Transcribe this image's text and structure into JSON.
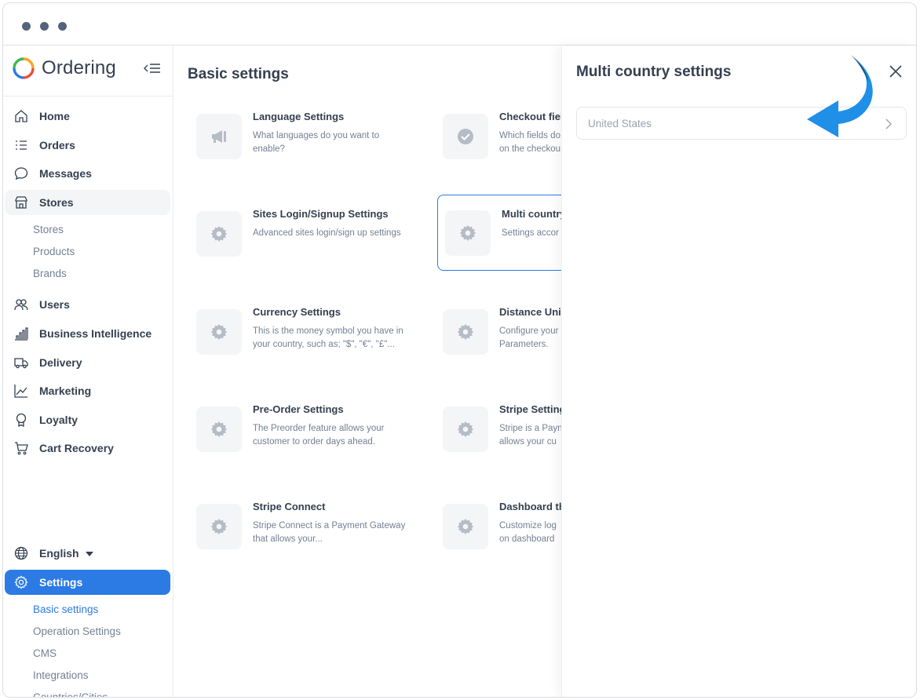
{
  "app": {
    "brand": "Ordering"
  },
  "sidebar": {
    "nav": [
      {
        "label": "Home",
        "icon": "home-icon"
      },
      {
        "label": "Orders",
        "icon": "list-icon"
      },
      {
        "label": "Messages",
        "icon": "chat-icon"
      },
      {
        "label": "Stores",
        "icon": "shop-icon"
      },
      {
        "label": "Users",
        "icon": "users-icon"
      },
      {
        "label": "Business Intelligence",
        "icon": "bar-chart-icon"
      },
      {
        "label": "Delivery",
        "icon": "truck-icon"
      },
      {
        "label": "Marketing",
        "icon": "graph-icon"
      },
      {
        "label": "Loyalty",
        "icon": "award-icon"
      },
      {
        "label": "Cart Recovery",
        "icon": "cart-icon"
      }
    ],
    "stores_sub": [
      "Stores",
      "Products",
      "Brands"
    ],
    "language": "English",
    "settings_label": "Settings",
    "settings_sub": [
      "Basic settings",
      "Operation Settings",
      "CMS",
      "Integrations",
      "Countries/Cities"
    ]
  },
  "main": {
    "title": "Basic settings",
    "cards": [
      {
        "title": "Language Settings",
        "desc": "What languages do you want to enable?",
        "icon": "megaphone-icon"
      },
      {
        "title": "Checkout fiel",
        "desc": "Which fields do\non the checkou",
        "icon": "check-circle-icon"
      },
      {
        "title": "Sites Login/Signup Settings",
        "desc": "Advanced sites login/sign up settings",
        "icon": "gear-icon"
      },
      {
        "title": "Multi country",
        "desc": "Settings accor",
        "icon": "gear-icon"
      },
      {
        "title": "Currency Settings",
        "desc": "This is the money symbol you have in your country, such as; \"$\", \"€\", \"£\"...",
        "icon": "gear-icon"
      },
      {
        "title": "Distance Unit",
        "desc": "Configure your\nParameters.",
        "icon": "gear-icon"
      },
      {
        "title": "Pre-Order Settings",
        "desc": "The Preorder feature allows your customer to order days ahead.",
        "icon": "gear-icon"
      },
      {
        "title": "Stripe Setting",
        "desc": "Stripe is a Payn\nallows your cu",
        "icon": "gear-icon"
      },
      {
        "title": "Stripe Connect",
        "desc": "Stripe Connect is a Payment Gateway that allows your...",
        "icon": "gear-icon"
      },
      {
        "title": "Dashboard th",
        "desc": "Customize log\non dashboard",
        "icon": "gear-icon"
      }
    ]
  },
  "panel": {
    "title": "Multi country settings",
    "country": "United States"
  },
  "colors": {
    "accent": "#2c7be5",
    "text": "#344050",
    "muted": "#748194",
    "arrow": "#1f8fe8"
  }
}
